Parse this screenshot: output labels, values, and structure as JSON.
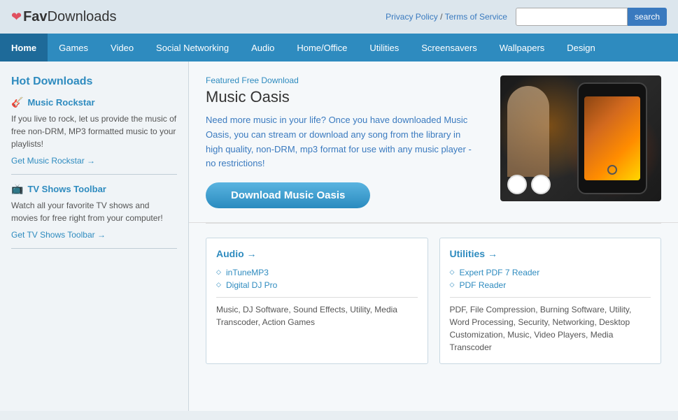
{
  "header": {
    "logo_heart": "❤",
    "logo_fav": "Fav",
    "logo_downloads": "Downloads",
    "privacy_link": "Privacy Policy",
    "separator": " / ",
    "terms_link": "Terms of Service",
    "search_placeholder": "",
    "search_button": "search"
  },
  "nav": {
    "items": [
      {
        "label": "Home",
        "active": true
      },
      {
        "label": "Games",
        "active": false
      },
      {
        "label": "Video",
        "active": false
      },
      {
        "label": "Social Networking",
        "active": false
      },
      {
        "label": "Audio",
        "active": false
      },
      {
        "label": "Home/Office",
        "active": false
      },
      {
        "label": "Utilities",
        "active": false
      },
      {
        "label": "Screensavers",
        "active": false
      },
      {
        "label": "Wallpapers",
        "active": false
      },
      {
        "label": "Design",
        "active": false
      }
    ]
  },
  "sidebar": {
    "title": "Hot Downloads",
    "items": [
      {
        "icon": "🎸",
        "title": "Music Rockstar",
        "desc": "If you live to rock, let us provide the music of free non-DRM, MP3 formatted music to your playlists!",
        "link": "Get Music Rockstar →"
      },
      {
        "icon": "📺",
        "title": "TV Shows Toolbar",
        "desc": "Watch all your favorite TV shows and movies for free right from your computer!",
        "link": "Get TV Shows Toolbar →"
      }
    ]
  },
  "featured": {
    "label_static": "Featured ",
    "label_highlight": "Free Download",
    "title": "Music Oasis",
    "desc": "Need more music in your life? Once you have downloaded Music Oasis, you can stream or download any song from the library in high quality, non-DRM, mp3 format for use with any music player - no restrictions!",
    "button": "Download Music Oasis"
  },
  "panels": [
    {
      "id": "audio",
      "title": "Audio →",
      "items": [
        "inTuneMP3",
        "Digital DJ Pro"
      ],
      "tags": "Music, DJ Software, Sound Effects, Utility, Media Transcoder, Action Games"
    },
    {
      "id": "utilities",
      "title": "Utilities →",
      "items": [
        "Expert PDF 7 Reader",
        "PDF Reader"
      ],
      "tags": "PDF, File Compression, Burning Software, Utility, Word Processing, Security, Networking, Desktop Customization, Music, Video Players, Media Transcoder"
    }
  ]
}
